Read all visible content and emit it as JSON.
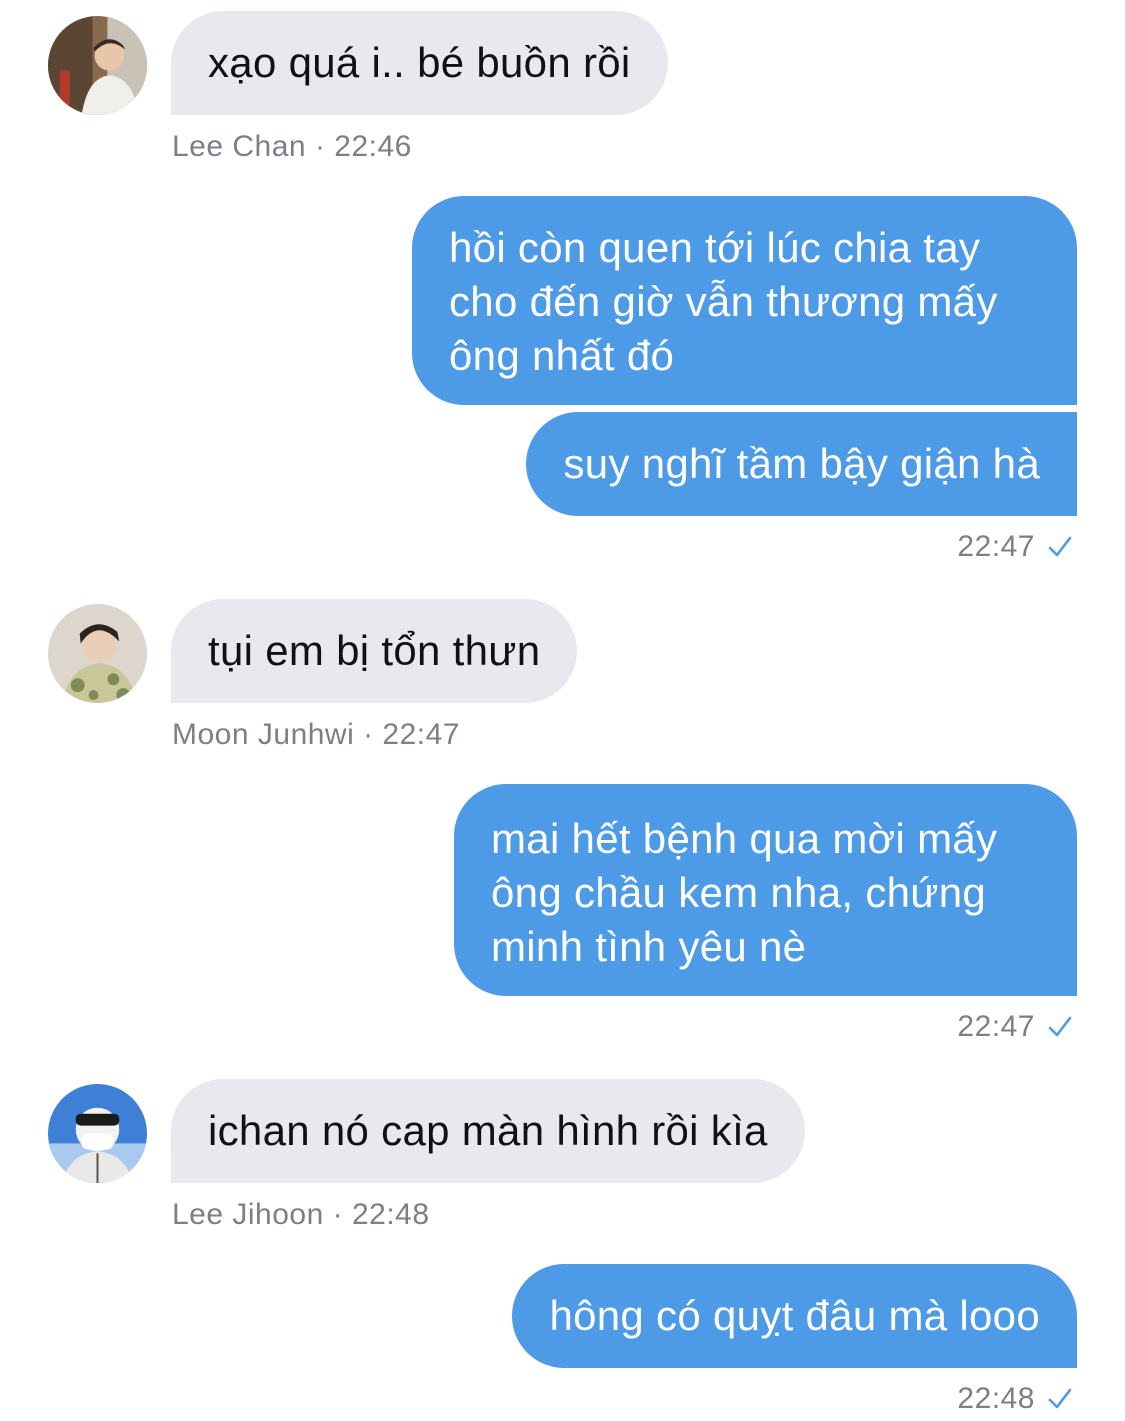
{
  "colors": {
    "incoming_bubble": "#e8e9ee",
    "outgoing_bubble": "#4d9ae7",
    "meta_text": "#7b8088",
    "read_check": "#4d9ae7"
  },
  "messages": [
    {
      "direction": "in",
      "text": "xạo quá i.. bé buồn rồi",
      "sender": "Lee Chan",
      "time": "22:46",
      "meta": "Lee Chan · 22:46",
      "avatar": "avatar-lee-chan"
    },
    {
      "direction": "out",
      "text": "hồi còn quen tới lúc chia tay cho đến giờ vẫn thương mấy ông nhất đó"
    },
    {
      "direction": "out",
      "text": "suy nghĩ tầm bậy giận hà",
      "time": "22:47",
      "status_icon": "check-icon"
    },
    {
      "direction": "in",
      "text": "tụi em bị tổn thưn",
      "sender": "Moon Junhwi",
      "time": "22:47",
      "meta": "Moon Junhwi · 22:47",
      "avatar": "avatar-moon-junhwi"
    },
    {
      "direction": "out",
      "text": "mai hết bệnh qua mời mấy ông chầu kem nha, chứng minh tình yêu nè",
      "time": "22:47",
      "status_icon": "check-icon"
    },
    {
      "direction": "in",
      "text": "ichan nó cap màn hình rồi kìa",
      "sender": "Lee Jihoon",
      "time": "22:48",
      "meta": "Lee Jihoon · 22:48",
      "avatar": "avatar-lee-jihoon"
    },
    {
      "direction": "out",
      "text": "hông có quỵt đâu mà looo",
      "time": "22:48",
      "status_icon": "check-icon"
    }
  ]
}
